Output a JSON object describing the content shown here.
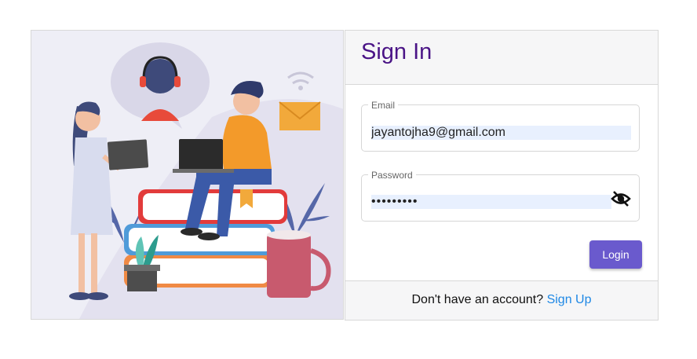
{
  "signin": {
    "title": "Sign In",
    "email": {
      "label": "Email",
      "value": "jayantojha9@gmail.com"
    },
    "password": {
      "label": "Password",
      "masked_value": "•••••••••",
      "toggle_icon": "eye-slash-icon"
    },
    "login_label": "Login",
    "footer_text": "Don't have an account?",
    "signup_label": "Sign Up"
  },
  "colors": {
    "title": "#4a1486",
    "button": "#6a5acd",
    "link": "#1e88e5",
    "autofill": "#e8f0fe"
  }
}
